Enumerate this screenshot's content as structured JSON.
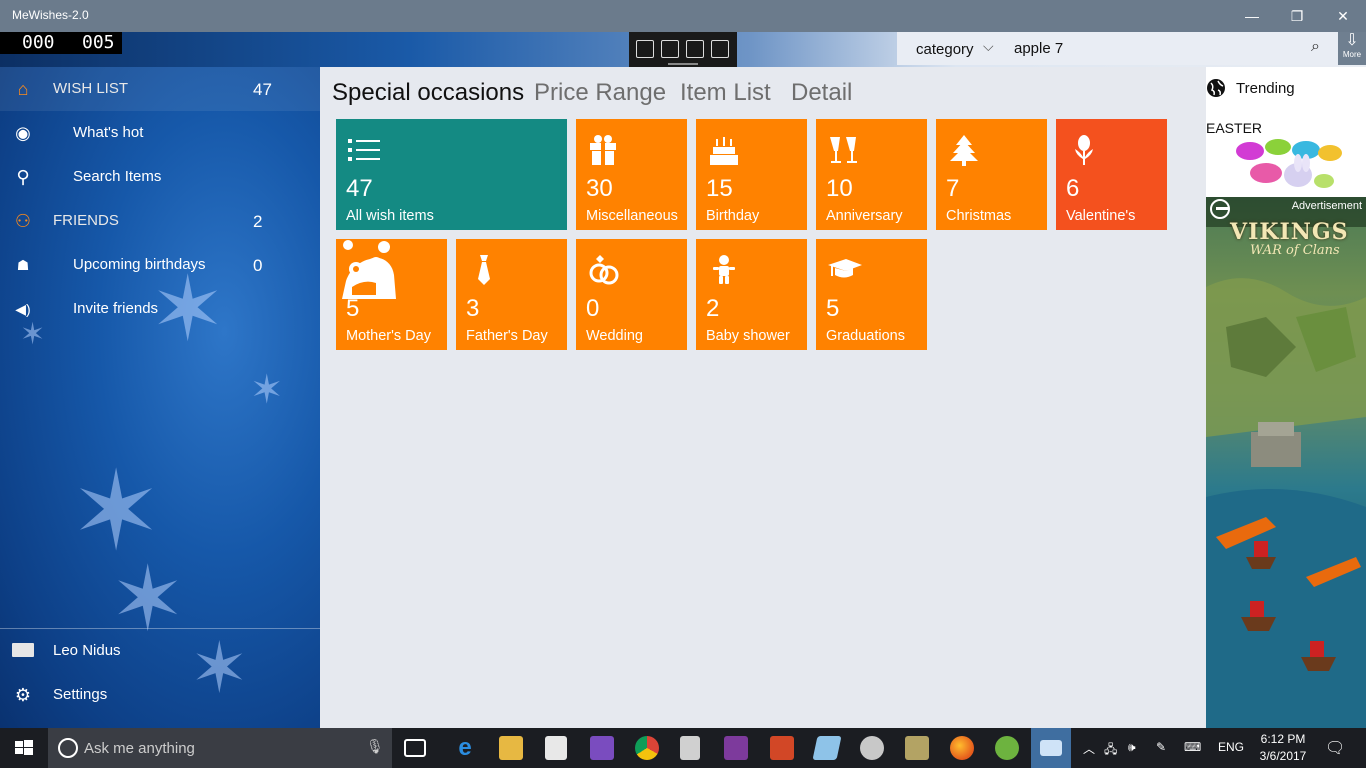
{
  "window": {
    "title": "MeWishes-2.0",
    "minimize": "—",
    "maximize": "❐",
    "close": "✕"
  },
  "counter": {
    "left": "000",
    "right": "005"
  },
  "search": {
    "category_label": "category",
    "query": "apple 7",
    "more_label": "More"
  },
  "sidebar": {
    "items": [
      {
        "label": "WISH LIST",
        "count": "47",
        "icon": "home-icon"
      },
      {
        "label": "What's hot",
        "icon": "radio-icon"
      },
      {
        "label": "Search Items",
        "icon": "search-icon"
      },
      {
        "label": "FRIENDS",
        "count": "2",
        "icon": "people-icon"
      },
      {
        "label": "Upcoming birthdays",
        "count": "0",
        "icon": "cake-icon"
      },
      {
        "label": "Invite friends",
        "icon": "megaphone-icon"
      }
    ],
    "user": {
      "name": "Leo Nidus",
      "icon": "user-card-icon"
    },
    "settings": {
      "label": "Settings",
      "icon": "gear-icon"
    }
  },
  "pivots": [
    "Special occasions",
    "Price Range",
    "Item List",
    "Detail"
  ],
  "tiles": [
    {
      "count": "47",
      "label": "All wish items",
      "icon": "list-icon",
      "color": "#148a83"
    },
    {
      "count": "30",
      "label": "Miscellaneous",
      "icon": "gift-icon",
      "color": "#ff8200"
    },
    {
      "count": "15",
      "label": "Birthday",
      "icon": "cake-icon",
      "color": "#ff8200"
    },
    {
      "count": "10",
      "label": "Anniversary",
      "icon": "glasses-icon",
      "color": "#ff8200"
    },
    {
      "count": "7",
      "label": "Christmas",
      "icon": "tree-icon",
      "color": "#ff8200"
    },
    {
      "count": "6",
      "label": "Valentine's",
      "icon": "flower-icon",
      "color": "#f4511e"
    },
    {
      "count": "5",
      "label": "Mother's Day",
      "icon": "mother-child-icon",
      "color": "#ff8200"
    },
    {
      "count": "3",
      "label": "Father's Day",
      "icon": "tie-icon",
      "color": "#ff8200"
    },
    {
      "count": "0",
      "label": "Wedding",
      "icon": "rings-icon",
      "color": "#ff8200"
    },
    {
      "count": "2",
      "label": "Baby shower",
      "icon": "baby-icon",
      "color": "#ff8200"
    },
    {
      "count": "5",
      "label": "Graduations",
      "icon": "grad-cap-icon",
      "color": "#ff8200"
    }
  ],
  "right_panel": {
    "trending_label": "Trending",
    "easter_label": "EASTER",
    "ad_label": "Advertisement",
    "ad_title": "VIKINGS",
    "ad_subtitle": "WAR of Clans"
  },
  "taskbar": {
    "search_placeholder": "Ask me anything",
    "language": "ENG",
    "time": "6:12 PM",
    "date": "3/6/2017"
  },
  "colors": {
    "accent_orange": "#ff8200",
    "teal_tile": "#148a83",
    "red_orange_tile": "#f4511e"
  }
}
